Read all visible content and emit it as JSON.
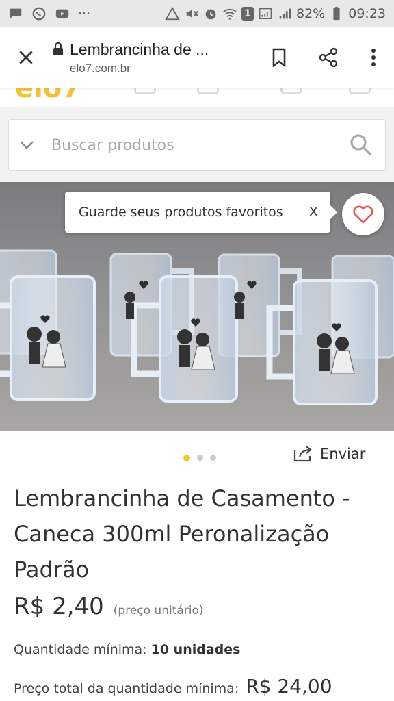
{
  "status_bar": {
    "dots": "···",
    "battery": "82%",
    "time": "09:23",
    "sim_slot": "1"
  },
  "browser": {
    "tab_title": "Lembrancinha de ...",
    "url": "elo7.com.br"
  },
  "search": {
    "placeholder": "Buscar produtos"
  },
  "tooltip": {
    "text": "Guarde seus produtos favoritos",
    "close": "x"
  },
  "gallery": {
    "share_label": "Enviar"
  },
  "product": {
    "title": "Lembrancinha de Casamento -Caneca 300ml Peronalização Padrão",
    "price": "R$ 2,40",
    "price_note": "(preço unitário)",
    "min_qty_label": "Quantidade mínima:",
    "min_qty_value": "10 unidades",
    "total_label": "Preço total da quantidade mínima:",
    "total_value": "R$ 24,00"
  },
  "colors": {
    "accent": "#f3c23b",
    "heart": "#e05a4f"
  }
}
